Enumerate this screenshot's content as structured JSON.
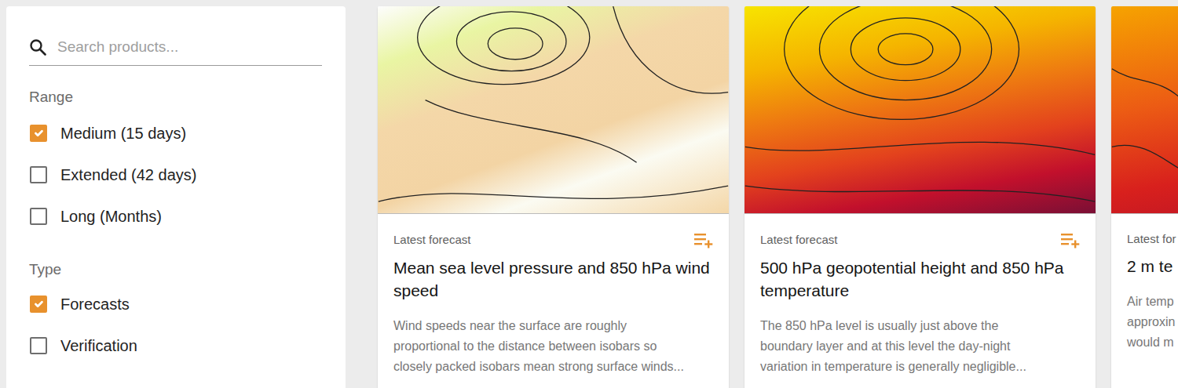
{
  "search": {
    "placeholder": "Search products..."
  },
  "filters": [
    {
      "heading": "Range",
      "options": [
        {
          "label": "Medium (15 days)",
          "checked": true
        },
        {
          "label": "Extended (42 days)",
          "checked": false
        },
        {
          "label": "Long (Months)",
          "checked": false
        }
      ]
    },
    {
      "heading": "Type",
      "options": [
        {
          "label": "Forecasts",
          "checked": true
        },
        {
          "label": "Verification",
          "checked": false
        }
      ]
    }
  ],
  "cards": [
    {
      "status": "Latest forecast",
      "title": "Mean sea level pressure and 850 hPa wind speed",
      "description": [
        "Wind speeds near the surface are roughly",
        "proportional to the distance between isobars so",
        "closely packed isobars mean strong surface winds..."
      ]
    },
    {
      "status": "Latest forecast",
      "title": "500 hPa geopotential height and 850 hPa temperature",
      "description": [
        "The 850 hPa level is usually just above the",
        "boundary layer and at this level the day-night",
        "variation in temperature is generally negligible..."
      ]
    },
    {
      "status": "Latest for",
      "title": "2 m te",
      "description": [
        "Air temp",
        "approxin",
        "would m"
      ]
    }
  ]
}
